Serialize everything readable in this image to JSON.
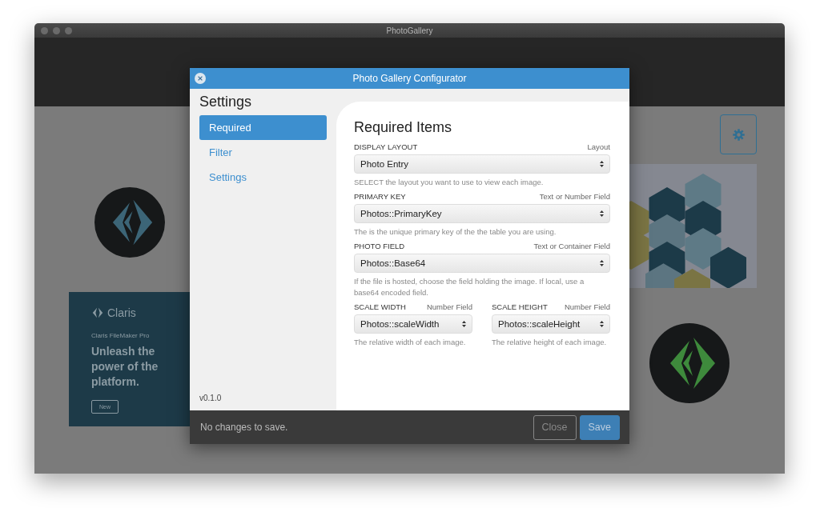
{
  "window": {
    "title": "PhotoGallery"
  },
  "background": {
    "banner": {
      "brand": "Claris",
      "product": "Claris FileMaker Pro",
      "headline": "Unleash the power of the platform.",
      "button": "New"
    }
  },
  "dialog": {
    "title": "Photo Gallery Configurator",
    "sidebar": {
      "heading": "Settings",
      "items": [
        {
          "label": "Required",
          "selected": true
        },
        {
          "label": "Filter",
          "selected": false
        },
        {
          "label": "Settings",
          "selected": false
        }
      ],
      "version": "v0.1.0"
    },
    "section_title": "Required Items",
    "fields": [
      {
        "label": "DISPLAY LAYOUT",
        "type_hint": "Layout",
        "value": "Photo Entry",
        "help": "SELECT the layout you want to use to view each image."
      },
      {
        "label": "PRIMARY KEY",
        "type_hint": "Text or Number Field",
        "value": "Photos::PrimaryKey",
        "help": "The is the unique primary key of the the table you are using."
      },
      {
        "label": "PHOTO FIELD",
        "type_hint": "Text or Container Field",
        "value": "Photos::Base64",
        "help": "If the file is hosted, choose the field holding the image. If local, use a base64 encoded field."
      }
    ],
    "scale_fields": [
      {
        "label": "SCALE WIDTH",
        "type_hint": "Number Field",
        "value": "Photos::scaleWidth",
        "help": "The relative width of each image."
      },
      {
        "label": "SCALE HEIGHT",
        "type_hint": "Number Field",
        "value": "Photos::scaleHeight",
        "help": "The relative height of each image."
      }
    ],
    "footer": {
      "status": "No changes to save.",
      "buttons": [
        {
          "label": "Close",
          "kind": "secondary"
        },
        {
          "label": "Save",
          "kind": "primary"
        }
      ]
    }
  }
}
